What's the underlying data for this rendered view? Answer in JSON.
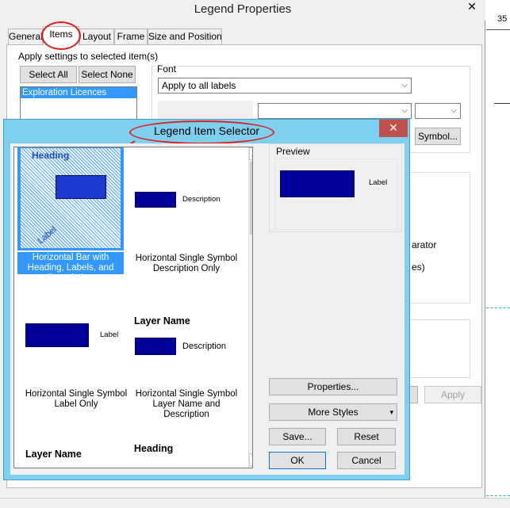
{
  "parent": {
    "title": "Legend Properties",
    "tabs": [
      "General",
      "Items",
      "Layout",
      "Frame",
      "Size and Position"
    ],
    "apply_settings_label": "Apply settings to selected item(s)",
    "select_all": "Select All",
    "select_none": "Select None",
    "list_items": [
      "Exploration Licences"
    ],
    "font_label": "Font",
    "font_scope_value": "Apply to all labels",
    "symbol_button": "Symbol...",
    "partial_text_1": "arator",
    "partial_text_2": "es)",
    "apply_button": "Apply",
    "right_edge_number": "35"
  },
  "selector": {
    "title": "Legend Item Selector",
    "close_glyph": "✕",
    "preview_label": "Preview",
    "preview_item_label": "Label",
    "items": [
      {
        "caption": "Horizontal Bar with Heading, Labels, and Description",
        "heading": "Heading",
        "label": "Label"
      },
      {
        "caption": "Horizontal Single Symbol Description Only",
        "description": "Description"
      },
      {
        "caption": "Horizontal Single Symbol Label Only",
        "label": "Label"
      },
      {
        "caption": "Horizontal Single Symbol Layer Name and Description",
        "layer_name": "Layer Name",
        "description": "Description"
      },
      {
        "layer_name": "Layer Name"
      },
      {
        "heading": "Heading"
      }
    ],
    "properties_button": "Properties...",
    "more_styles_button": "More Styles",
    "save_button": "Save...",
    "reset_button": "Reset",
    "ok_button": "OK",
    "cancel_button": "Cancel"
  },
  "colors": {
    "symbol_fill": "#000099",
    "selection": "#3399ff",
    "titlebar_child": "#7fd0f0",
    "close_red": "#c0504d",
    "annotation_red": "#e0201f"
  },
  "icons": [
    "close-icon",
    "dropdown-arrow-icon",
    "scroll-up-icon",
    "scroll-down-icon",
    "scroll-grip-icon"
  ]
}
